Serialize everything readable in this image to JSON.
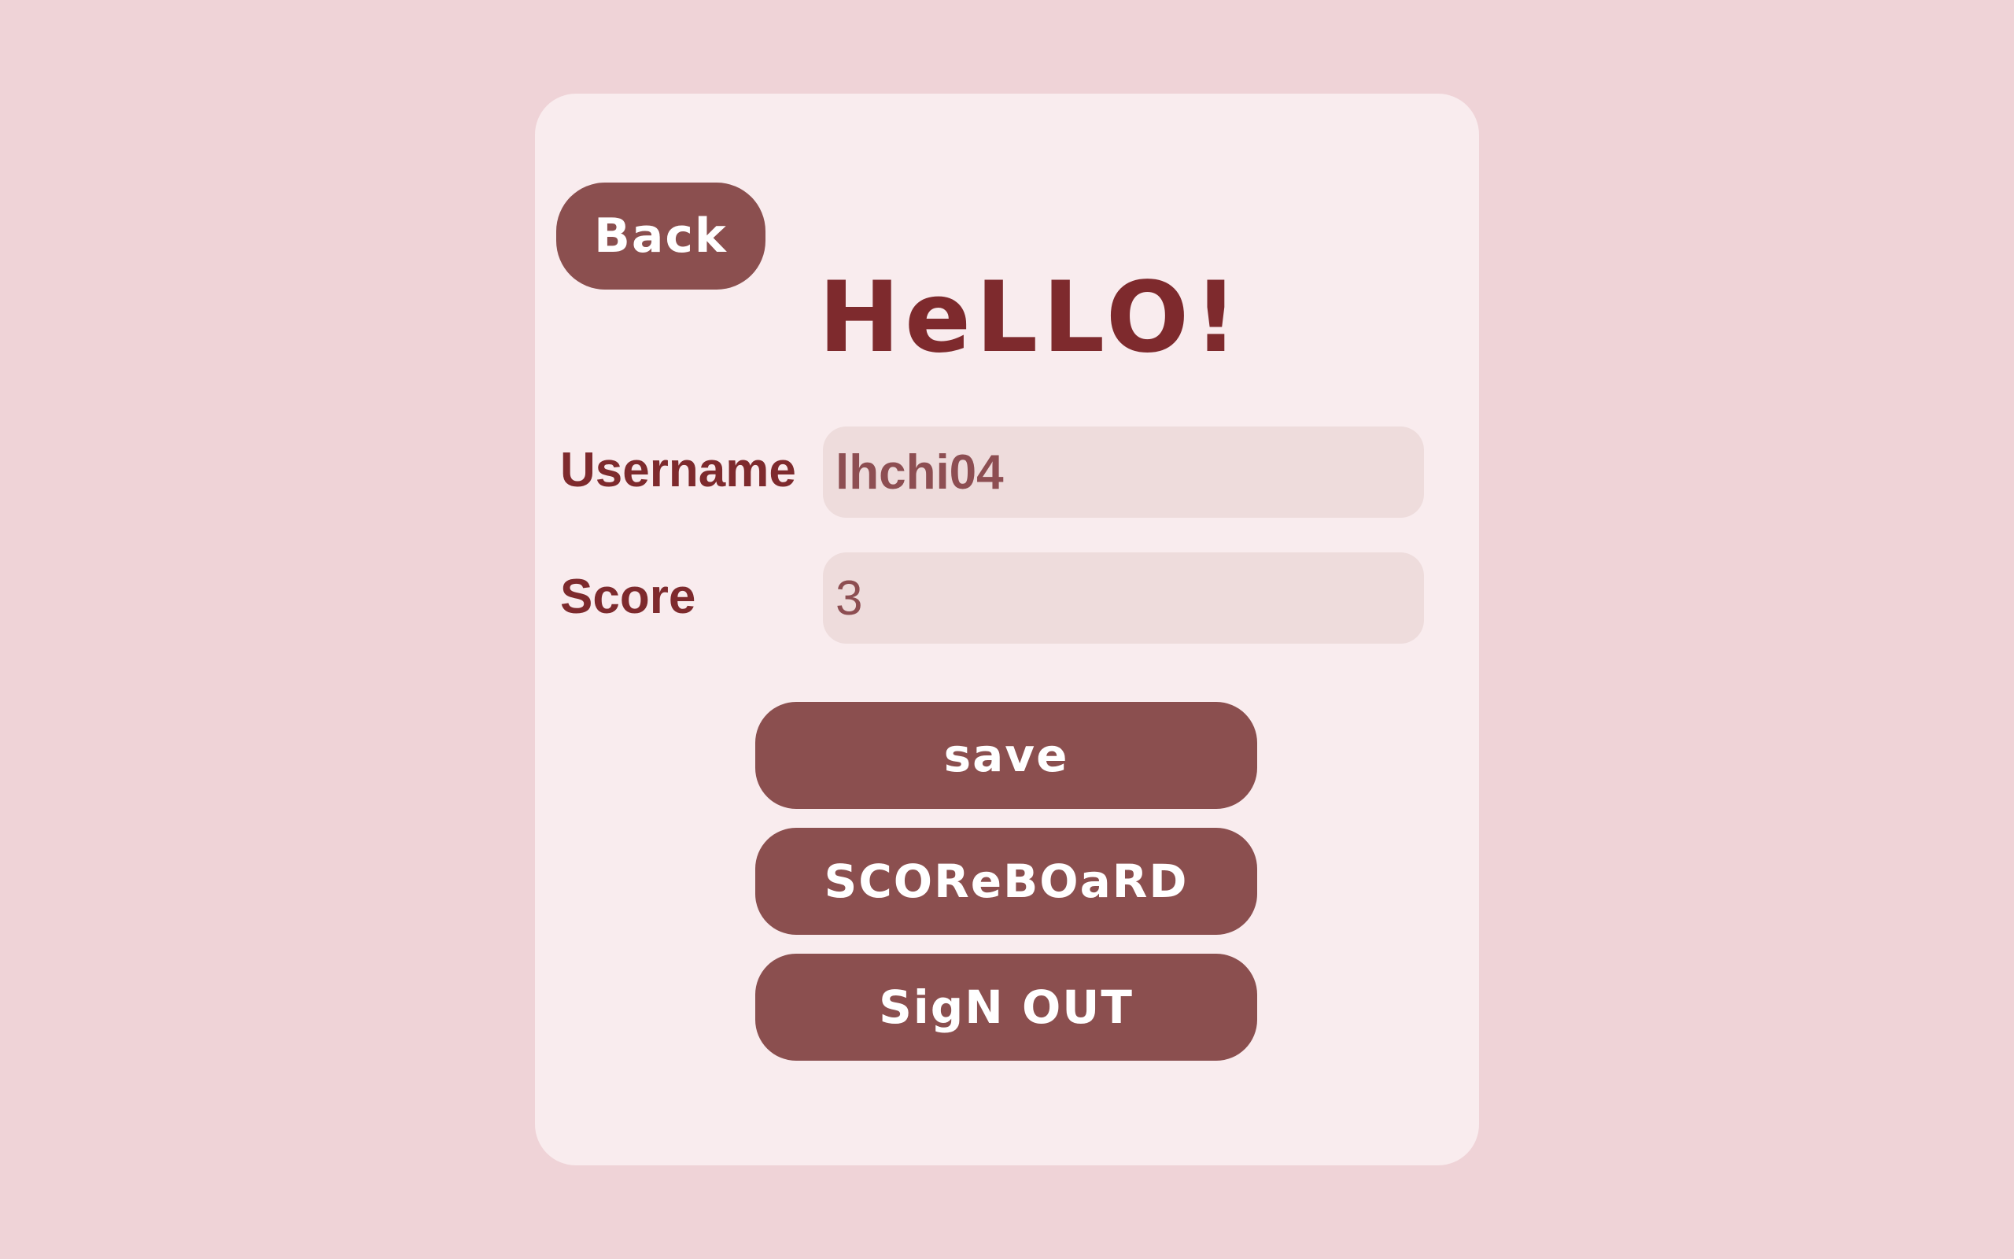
{
  "header": {
    "back_label": "Back",
    "title": "HeLLO!"
  },
  "form": {
    "username_label": "Username",
    "username_value": "lhchi04",
    "score_label": "Score",
    "score_value": "3"
  },
  "actions": {
    "save_label": "save",
    "scoreboard_label": "SCOReBOaRD",
    "signout_label": "SigN OUT"
  },
  "colors": {
    "background": "#efd3d7",
    "card": "#f9ecee",
    "button": "#8b4f4f",
    "accent_text": "#7e2a2d",
    "input_background": "#eedcdc"
  }
}
